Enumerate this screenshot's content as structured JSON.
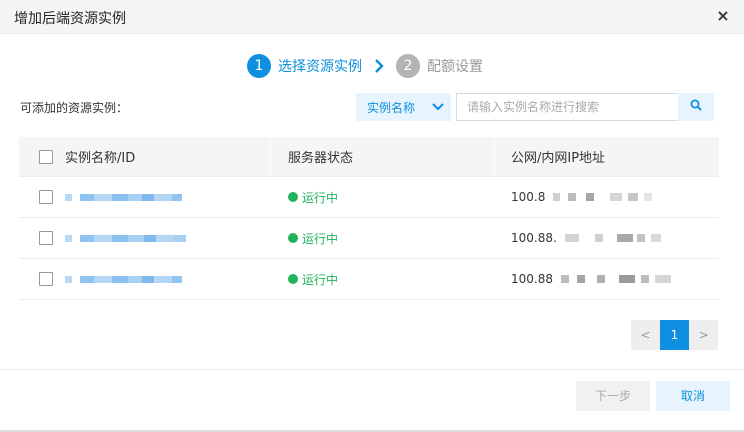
{
  "dialog": {
    "title": "增加后端资源实例",
    "close_label": "×"
  },
  "steps": [
    {
      "number": "1",
      "label": "选择资源实例",
      "state": "active"
    },
    {
      "number": "2",
      "label": "配额设置",
      "state": "inactive"
    }
  ],
  "available_label": "可添加的资源实例：",
  "search": {
    "filter_label": "实例名称",
    "placeholder": "请输入实例名称进行搜索",
    "search_icon": "search-icon"
  },
  "table": {
    "headers": [
      "实例名称/ID",
      "服务器状态",
      "公网/内网IP地址"
    ],
    "rows": [
      {
        "status": "运行中",
        "ip_prefix": "100.8"
      },
      {
        "status": "运行中",
        "ip_prefix": "100.88."
      },
      {
        "status": "运行中",
        "ip_prefix": "100.88"
      }
    ]
  },
  "pagination": {
    "prev": "<",
    "current": "1",
    "next": ">"
  },
  "footer": {
    "next_label": "下一步",
    "cancel_label": "取消"
  },
  "colors": {
    "accent": "#0e8fe0",
    "running": "#1fb35b",
    "inactive_step": "#b4b4b4"
  }
}
